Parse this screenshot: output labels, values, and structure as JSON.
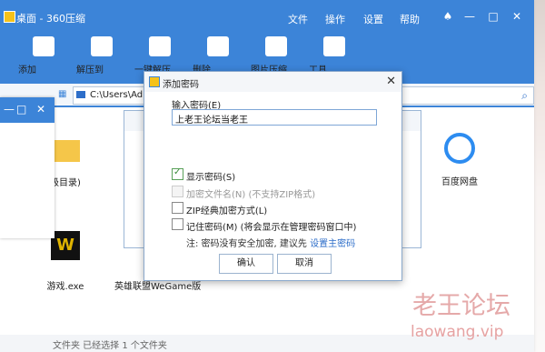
{
  "window": {
    "title": "桌面 - 360压缩"
  },
  "menu": [
    "文件",
    "操作",
    "设置",
    "帮助"
  ],
  "toolbar": [
    "添加",
    "解压到",
    "一键解压",
    "删除",
    "图片压缩",
    "工具"
  ],
  "address": {
    "path": "C:\\Users\\Adm"
  },
  "files": [
    {
      "name": "级目录)"
    },
    {
      "name": "百度网盘"
    },
    {
      "name": "游戏.exe"
    },
    {
      "name": "英雄联盟WeGame版"
    }
  ],
  "status": {
    "text": "文件夹 已经选择 1 个文件夹"
  },
  "dialog": {
    "title": "添加密码",
    "password_label": "输入密码(E)",
    "password_value": "上老王论坛当老王",
    "options": [
      {
        "label": "显示密码(S)",
        "checked": true,
        "disabled": false
      },
      {
        "label": "加密文件名(N) (不支持ZIP格式)",
        "checked": false,
        "disabled": true
      },
      {
        "label": "ZIP经典加密方式(L)",
        "checked": false,
        "disabled": false
      },
      {
        "label": "记住密码(M) (将会显示在管理密码窗口中)",
        "checked": false,
        "disabled": false
      }
    ],
    "note_text": "注: 密码没有安全加密, 建议先",
    "note_link": "设置主密码",
    "ok": "确认",
    "cancel": "取消"
  },
  "watermark": {
    "line1": "老王论坛",
    "line2": "laowang.vip"
  },
  "colors": {
    "accent": "#3c84d8",
    "link": "#2d6ec9"
  }
}
